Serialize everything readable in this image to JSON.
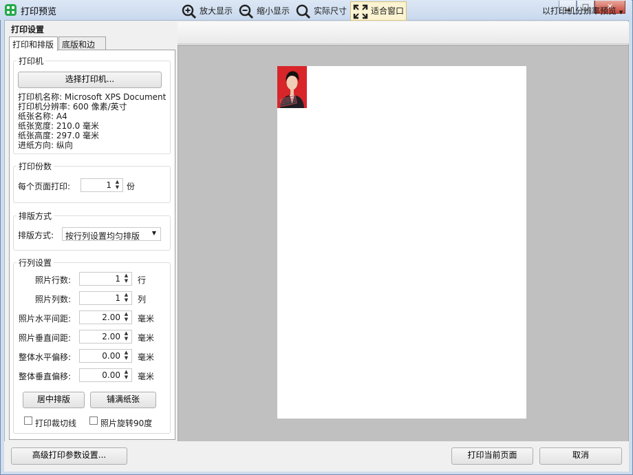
{
  "window": {
    "title": "打印预览",
    "minimize": "▁",
    "maximize": "□",
    "close": "✕"
  },
  "panel": {
    "title": "打印设置",
    "tabs": [
      {
        "label": "打印和排版",
        "active": true
      },
      {
        "label": "底版和边框",
        "active": false
      }
    ],
    "printer_group": {
      "title": "打印机",
      "select_button": "选择打印机...",
      "info": [
        "打印机名称: Microsoft XPS Document",
        "打印机分辨率: 600 像素/英寸",
        "纸张名称: A4",
        "纸张宽度: 210.0 毫米",
        "纸张高度: 297.0 毫米",
        "进纸方向: 纵向"
      ]
    },
    "copies_group": {
      "title": "打印份数",
      "label": "每个页面打印:",
      "value": "1",
      "unit": "份"
    },
    "layout_group": {
      "title": "排版方式",
      "label": "排版方式:",
      "selected": "按行列设置均匀排版"
    },
    "grid_group": {
      "title": "行列设置",
      "rows": [
        {
          "label": "照片行数:",
          "value": "1",
          "unit": "行"
        },
        {
          "label": "照片列数:",
          "value": "1",
          "unit": "列"
        },
        {
          "label": "照片水平间距:",
          "value": "2.00",
          "unit": "毫米"
        },
        {
          "label": "照片垂直间距:",
          "value": "2.00",
          "unit": "毫米"
        },
        {
          "label": "整体水平偏移:",
          "value": "0.00",
          "unit": "毫米"
        },
        {
          "label": "整体垂直偏移:",
          "value": "0.00",
          "unit": "毫米"
        }
      ],
      "center_button": "居中排版",
      "fill_button": "铺满纸张",
      "checkboxes": [
        {
          "label": "打印裁切线",
          "checked": false
        },
        {
          "label": "照片旋转90度",
          "checked": false
        }
      ]
    }
  },
  "toolbar": {
    "zoom_in": "放大显示",
    "zoom_out": "缩小显示",
    "actual_size": "实际尺寸",
    "fit_window": "适合窗口",
    "preview_mode": "以打印机分辨率预览"
  },
  "photo": {
    "stamp": "证件照"
  },
  "bottom": {
    "advanced_button": "高级打印参数设置...",
    "print_button": "打印当前页面",
    "cancel_button": "取消"
  },
  "colors": {
    "photo_background": "#d8252a",
    "app_icon": "#25a94a",
    "preview_background": "#c0c0c0"
  }
}
